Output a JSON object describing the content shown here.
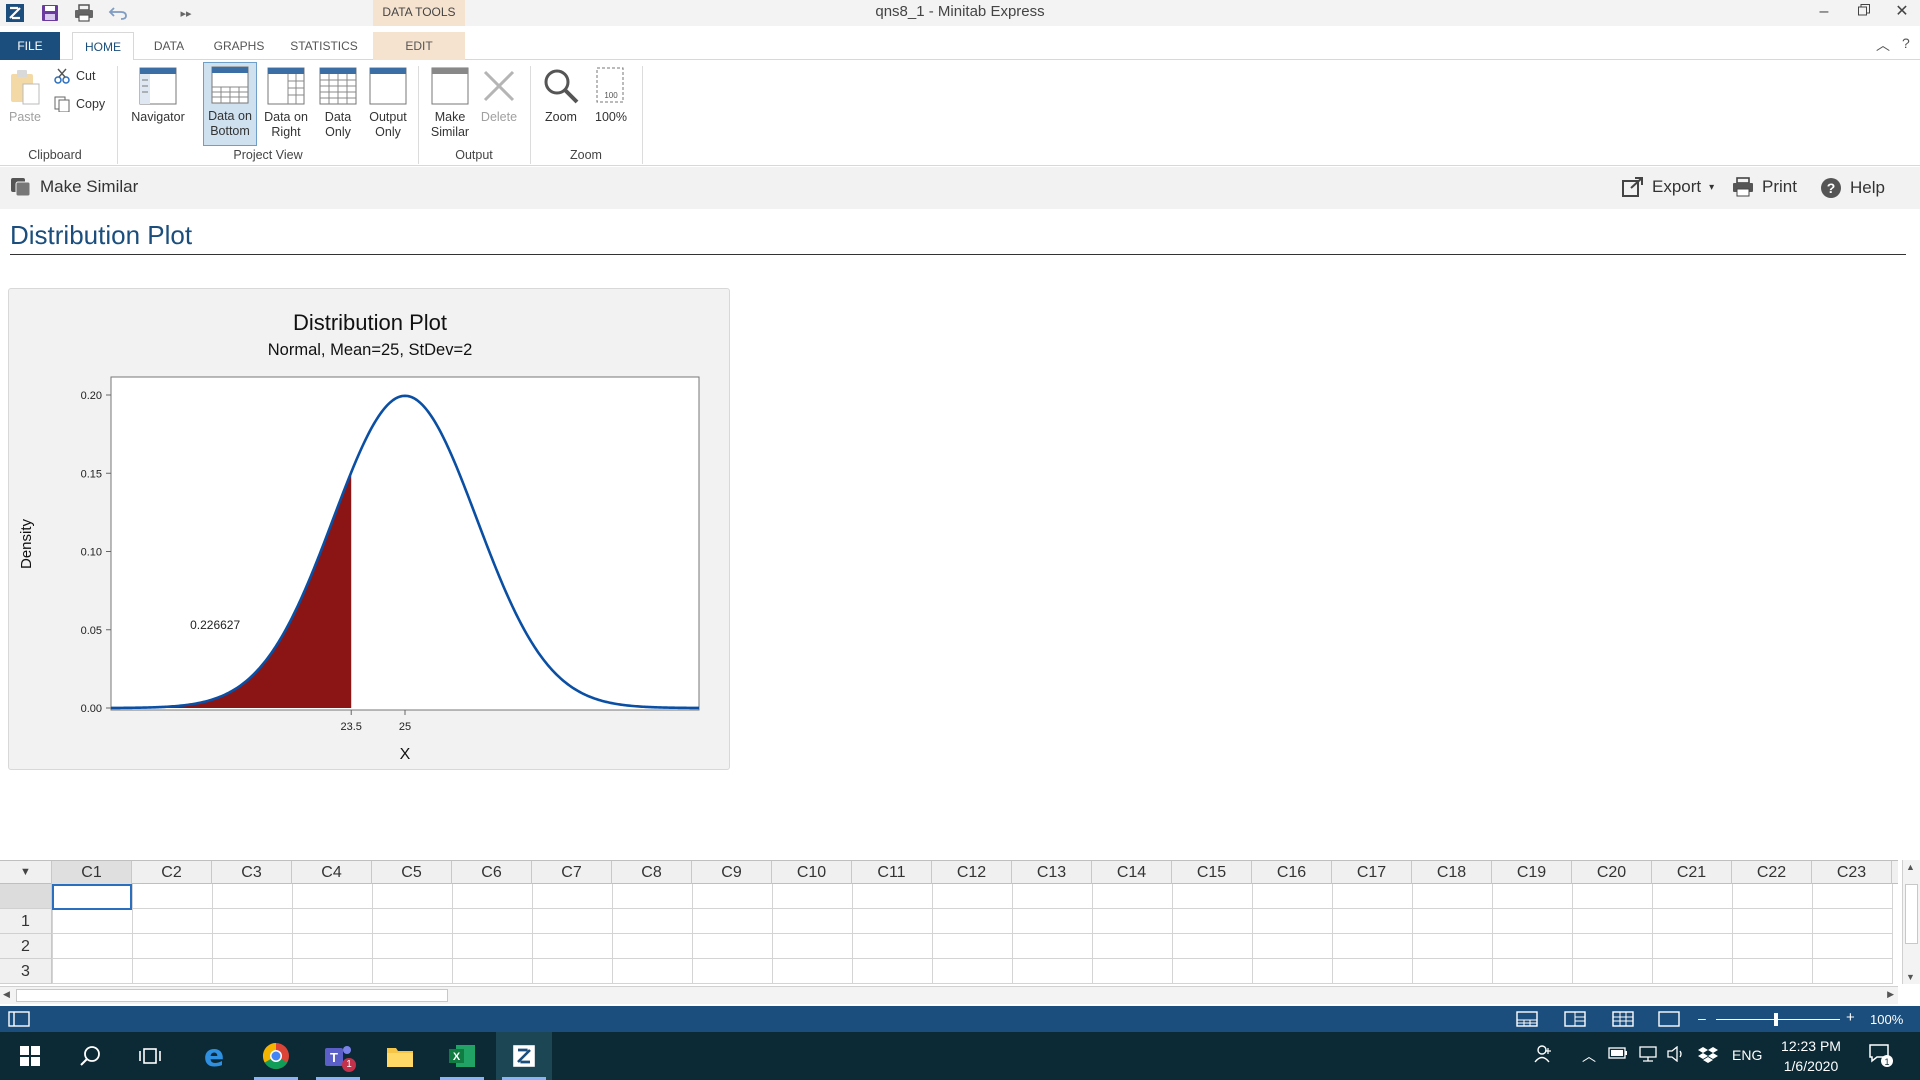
{
  "window": {
    "title": "qns8_1 - Minitab Express",
    "context_label": "DATA TOOLS"
  },
  "tabs": {
    "file": "FILE",
    "home": "HOME",
    "data": "DATA",
    "graphs": "GRAPHS",
    "statistics": "STATISTICS",
    "edit": "EDIT"
  },
  "ribbon": {
    "clipboard": {
      "group": "Clipboard",
      "paste": "Paste",
      "cut": "Cut",
      "copy": "Copy"
    },
    "project_view": {
      "group": "Project View",
      "navigator": "Navigator",
      "data_on_bottom": [
        "Data on",
        "Bottom"
      ],
      "data_on_right": [
        "Data on",
        "Right"
      ],
      "data_only": [
        "Data",
        "Only"
      ],
      "output_only": [
        "Output",
        "Only"
      ]
    },
    "output": {
      "group": "Output",
      "make_similar": [
        "Make",
        "Similar"
      ],
      "delete": "Delete"
    },
    "zoom": {
      "group": "Zoom",
      "zoom": "Zoom",
      "hundred": "100%"
    }
  },
  "command_bar": {
    "make_similar": "Make Similar",
    "export": "Export",
    "print": "Print",
    "help": "Help"
  },
  "output": {
    "heading": "Distribution Plot"
  },
  "chart_data": {
    "type": "area",
    "title": "Distribution Plot",
    "subtitle": "Normal, Mean=25, StDev=2",
    "distribution": {
      "family": "Normal",
      "mean": 25,
      "stdev": 2
    },
    "xlabel": "X",
    "ylabel": "Density",
    "xlim": [
      16.8,
      33.2
    ],
    "ylim": [
      0,
      0.2
    ],
    "y_ticks": [
      "0.00",
      "0.05",
      "0.10",
      "0.15",
      "0.20"
    ],
    "x_ticks": [
      "23.5",
      "25"
    ],
    "x_tick_values": [
      23.5,
      25
    ],
    "shaded_region": {
      "from": 16.8,
      "to": 23.5,
      "area_label": "0.226627",
      "color": "#8b1414"
    },
    "curve_color": "#0a4fa3",
    "grid": false,
    "legend": "none"
  },
  "sheet": {
    "columns": [
      "C1",
      "C2",
      "C3",
      "C4",
      "C5",
      "C6",
      "C7",
      "C8",
      "C9",
      "C10",
      "C11",
      "C12",
      "C13",
      "C14",
      "C15",
      "C16",
      "C17",
      "C18",
      "C19",
      "C20",
      "C21",
      "C22",
      "C23"
    ],
    "rows": [
      "1",
      "2",
      "3"
    ]
  },
  "status": {
    "zoom": "100%"
  },
  "taskbar": {
    "time": "12:23 PM",
    "date": "1/6/2020",
    "lang": "ENG",
    "teams_badge": "1",
    "notification_count": "1"
  },
  "colors": {
    "brand": "#1b4e7c",
    "context_tab": "#f6e3cf",
    "shade": "#8b1414",
    "curve": "#0a4fa3"
  }
}
